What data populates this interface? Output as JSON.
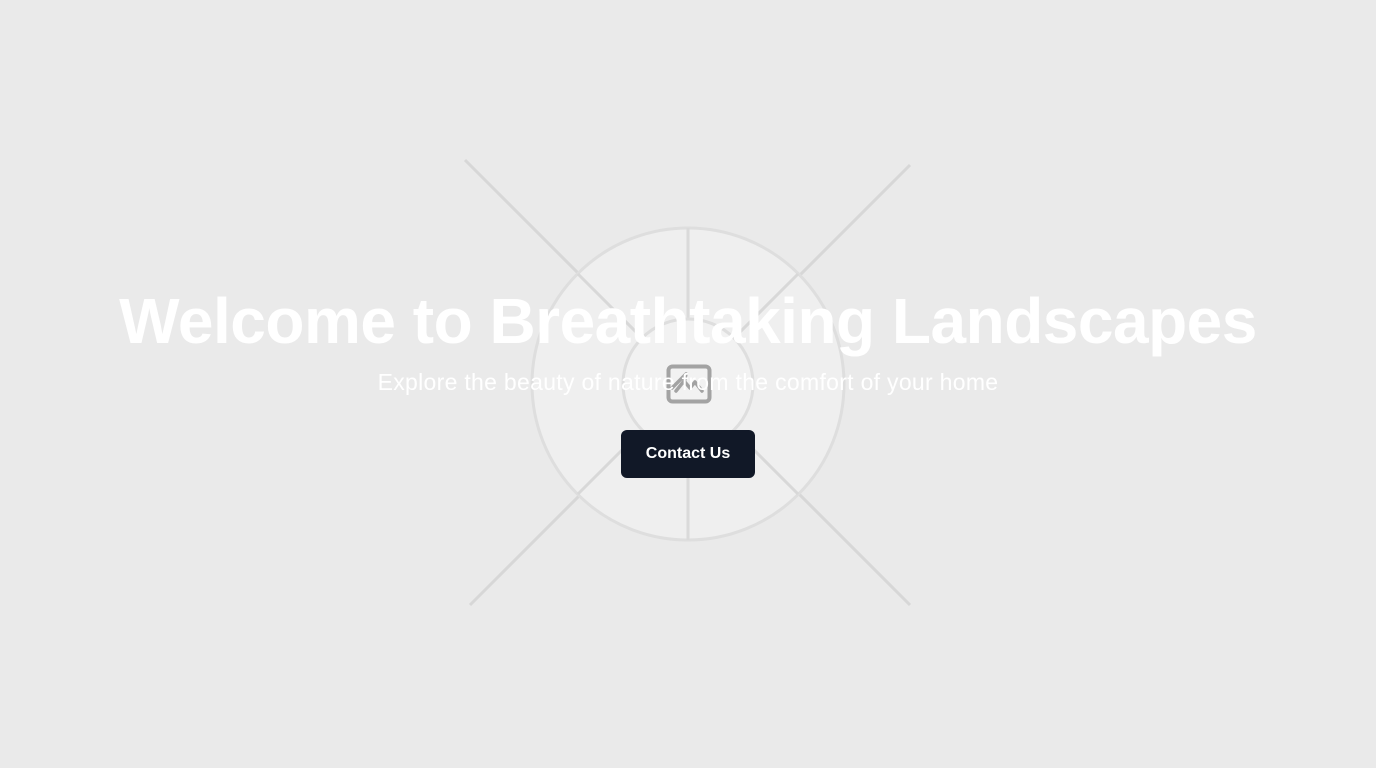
{
  "hero": {
    "title": "Welcome to Breathtaking Landscapes",
    "subtitle": "Explore the beauty of nature from the comfort of your home",
    "cta_label": "Contact Us",
    "background_image_icon": "image-placeholder-icon"
  },
  "colors": {
    "page_background": "#eaeaea",
    "title_text": "#ffffff",
    "button_background": "#111827",
    "button_text": "#ffffff"
  }
}
